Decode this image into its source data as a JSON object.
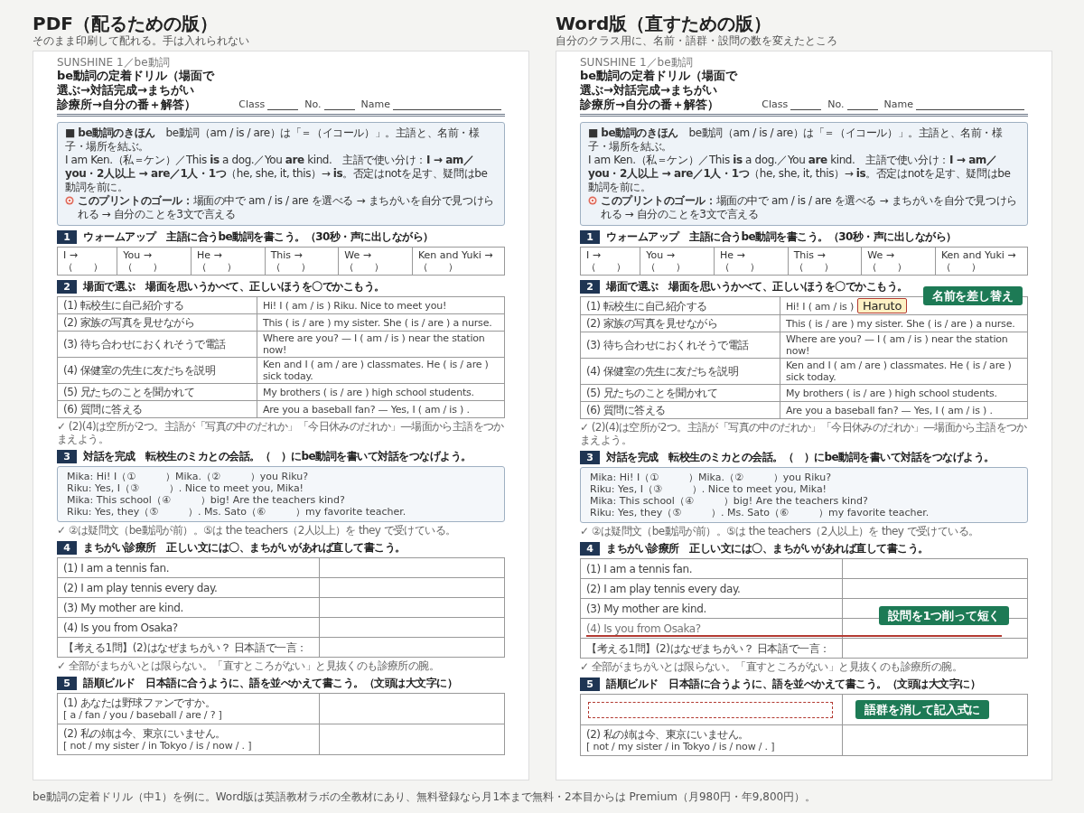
{
  "panels": [
    {
      "title": "PDF（配るための版）",
      "subtitle": "そのまま印刷して配れる。手は入れられない",
      "document": {
        "series": "SUNSHINE 1／be動詞",
        "title_lines": [
          "be動詞の定着ドリル（場面で",
          "選ぶ→対話完成→まちがい",
          "診療所→自分の番＋解答）"
        ],
        "fields": [
          "Class",
          "No.",
          "Name"
        ],
        "info": [
          "■ **be動詞のきほん**　be動詞（am / is / are）は「＝（イコール）」。主語と、名前・様子・場所を結ぶ。",
          "I am Ken.（私＝ケン）／This **is** a dog.／You **are** kind.　主語で使い分け：**I → am／you・2人以上 → are／1人・1つ**（he, she, it, this）→ **is**。否定はnotを足す、疑問はbe動詞を前に。",
          "**このプリントのゴール：**場面の中で am / is / are を選べる → まちがいを自分で見つけられる → 自分のことを3文で言える"
        ],
        "sections": [
          {
            "number": "1",
            "kind": "warmup",
            "heading": "ウォームアップ　主語に合うbe動詞を書こう。（30秒・声に出しながら）",
            "cells": [
              [
                "I →（　　）"
              ],
              [
                "You →",
                "（　　）"
              ],
              [
                "He →",
                "（　　）"
              ],
              [
                "This →",
                "（　　）"
              ],
              [
                "We →",
                "（　　）"
              ],
              [
                "Ken and Yuki →",
                "（　　）"
              ]
            ]
          },
          {
            "number": "2",
            "kind": "choice",
            "heading": "場面で選ぶ　場面を思いうかべて、正しいほうを〇でかこもう。",
            "rows": [
              {
                "situation": "(1) 転校生に自己紹介する",
                "sentence": "Hi! I ( am / is ) Riku. Nice to meet you!"
              },
              {
                "situation": "(2) 家族の写真を見せながら",
                "sentence": "This ( is / are ) my sister. She ( is / are ) a nurse."
              },
              {
                "situation": "(3) 待ち合わせにおくれそうで電話",
                "sentence": "Where are you? — I ( am / is ) near the station now!"
              },
              {
                "situation": "(4) 保健室の先生に友だちを説明",
                "sentence": "Ken and I ( am / are ) classmates. He ( is / are ) sick today."
              },
              {
                "situation": "(5) 兄たちのことを聞かれて",
                "sentence": "My brothers ( is / are ) high school students."
              },
              {
                "situation": "(6) 質問に答える",
                "sentence": "Are you a baseball fan? — Yes, I ( am / is ) ."
              }
            ],
            "note": "✓ (2)(4)は空所が2つ。主語が「写真の中のだれか」「今日休みのだれか」―場面から主語をつかまえよう。"
          },
          {
            "number": "3",
            "kind": "dialogue",
            "heading": "対話を完成　転校生のミカとの会話。（　）にbe動詞を書いて対話をつなげよう。",
            "lines": [
              "Mika: Hi! I（①　　　）Mika.（②　　　）you Riku?",
              "Riku: Yes, I（③　　　）. Nice to meet you, Mika!",
              "Mika: This school（④　　　）big! Are the teachers kind?",
              "Riku: Yes, they（⑤　　　）. Ms. Sato（⑥　　　）my favorite teacher."
            ],
            "note": "✓ ②は疑問文（be動詞が前）。⑤は the teachers（2人以上）を they で受けている。"
          },
          {
            "number": "4",
            "kind": "correction",
            "heading": "まちがい診療所　正しい文には〇、まちがいがあれば直して書こう。",
            "rows": [
              {
                "text": "(1) I am a tennis fan.",
                "struck": false
              },
              {
                "text": "(2) I am play tennis every day.",
                "struck": false
              },
              {
                "text": "(3) My mother are kind.",
                "struck": false
              },
              {
                "text": "(4) Is you from Osaka?",
                "struck": false
              },
              {
                "text": "【考える1問】(2)はなぜまちがい？ 日本語で一言：",
                "struck": false
              }
            ],
            "note": "✓ 全部がまちがいとは限らない。「直すところがない」と見抜くのも診療所の腕。"
          },
          {
            "number": "5",
            "kind": "reorder",
            "heading": "語順ビルド　日本語に合うように、語を並べかえて書こう。（文頭は大文字に）",
            "rows": [
              {
                "prompt": "(1) あなたは野球ファンですか。",
                "words": "[ a / fan / you / baseball / are / ? ]",
                "erased": false
              },
              {
                "prompt": "(2) 私の姉は今、東京にいません。",
                "words": "[ not / my sister / in Tokyo / is / now / . ]",
                "erased": false
              }
            ]
          }
        ]
      }
    },
    {
      "title": "Word版（直すための版）",
      "subtitle": "自分のクラス用に、名前・語群・設問の数を変えたところ",
      "document": {
        "series": "SUNSHINE 1／be動詞",
        "title_lines": [
          "be動詞の定着ドリル（場面で",
          "選ぶ→対話完成→まちがい",
          "診療所→自分の番＋解答）"
        ],
        "fields": [
          "Class",
          "No.",
          "Name"
        ],
        "info": [
          "■ **be動詞のきほん**　be動詞（am / is / are）は「＝（イコール）」。主語と、名前・様子・場所を結ぶ。",
          "I am Ken.（私＝ケン）／This **is** a dog.／You **are** kind.　主語で使い分け：**I → am／you・2人以上 → are／1人・1つ**（he, she, it, this）→ **is**。否定はnotを足す、疑問はbe動詞を前に。",
          "**このプリントのゴール：**場面の中で am / is / are を選べる → まちがいを自分で見つけられる → 自分のことを3文で言える"
        ],
        "sections": [
          {
            "number": "1",
            "kind": "warmup",
            "heading": "ウォームアップ　主語に合うbe動詞を書こう。（30秒・声に出しながら）",
            "cells": [
              [
                "I →（　　）"
              ],
              [
                "You →",
                "（　　）"
              ],
              [
                "He →",
                "（　　）"
              ],
              [
                "This →",
                "（　　）"
              ],
              [
                "We →",
                "（　　）"
              ],
              [
                "Ken and Yuki →",
                "（　　）"
              ]
            ]
          },
          {
            "number": "2",
            "kind": "choice",
            "heading": "場面で選ぶ　場面を思いうかべて、正しいほうを〇でかこもう。",
            "rows": [
              {
                "situation": "(1) 転校生に自己紹介する",
                "sentence": "Hi! I ( am / is )",
                "replacement": "Haruto",
                "callout": "名前を差し替え"
              },
              {
                "situation": "(2) 家族の写真を見せながら",
                "sentence": "This ( is / are ) my sister. She ( is / are ) a nurse."
              },
              {
                "situation": "(3) 待ち合わせにおくれそうで電話",
                "sentence": "Where are you? — I ( am / is ) near the station now!"
              },
              {
                "situation": "(4) 保健室の先生に友だちを説明",
                "sentence": "Ken and I ( am / are ) classmates. He ( is / are ) sick today."
              },
              {
                "situation": "(5) 兄たちのことを聞かれて",
                "sentence": "My brothers ( is / are ) high school students."
              },
              {
                "situation": "(6) 質問に答える",
                "sentence": "Are you a baseball fan? — Yes, I ( am / is ) ."
              }
            ],
            "note": "✓ (2)(4)は空所が2つ。主語が「写真の中のだれか」「今日休みのだれか」―場面から主語をつかまえよう。"
          },
          {
            "number": "3",
            "kind": "dialogue",
            "heading": "対話を完成　転校生のミカとの会話。（　）にbe動詞を書いて対話をつなげよう。",
            "lines": [
              "Mika: Hi! I（①　　　）Mika.（②　　　）you Riku?",
              "Riku: Yes, I（③　　　）. Nice to meet you, Mika!",
              "Mika: This school（④　　　）big! Are the teachers kind?",
              "Riku: Yes, they（⑤　　　）. Ms. Sato（⑥　　　）my favorite teacher."
            ],
            "note": "✓ ②は疑問文（be動詞が前）。⑤は the teachers（2人以上）を they で受けている。"
          },
          {
            "number": "4",
            "kind": "correction",
            "heading": "まちがい診療所　正しい文には〇、まちがいがあれば直して書こう。",
            "rows": [
              {
                "text": "(1) I am a tennis fan.",
                "struck": false
              },
              {
                "text": "(2) I am play tennis every day.",
                "struck": false
              },
              {
                "text": "(3) My mother are kind.",
                "struck": false
              },
              {
                "text": "(4) Is you from Osaka?",
                "struck": true,
                "callout": "設問を1つ削って短く"
              },
              {
                "text": "【考える1問】(2)はなぜまちがい？ 日本語で一言：",
                "struck": false
              }
            ],
            "note": "✓ 全部がまちがいとは限らない。「直すところがない」と見抜くのも診療所の腕。"
          },
          {
            "number": "5",
            "kind": "reorder",
            "heading": "語順ビルド　日本語に合うように、語を並べかえて書こう。（文頭は大文字に）",
            "rows": [
              {
                "erased": true,
                "callout": "語群を消して記入式に"
              },
              {
                "prompt": "(2) 私の姉は今、東京にいません。",
                "words": "[ not / my sister / in Tokyo / is / now / . ]",
                "erased": false
              }
            ]
          }
        ]
      }
    }
  ],
  "footer": "be動詞の定着ドリル（中1）を例に。Word版は英語教材ラボの全教材にあり、無料登録なら月1本まで無料・2本目からは Premium（月980円・年9,800円）。"
}
